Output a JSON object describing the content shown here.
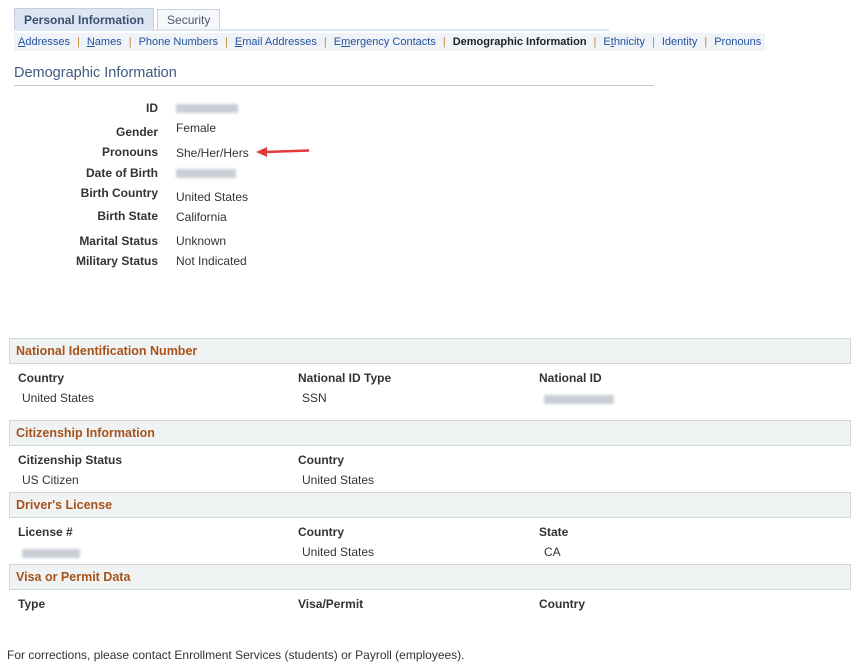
{
  "tabs": [
    {
      "label": "Personal Information",
      "active": true
    },
    {
      "label": "Security",
      "active": false
    }
  ],
  "subnav": {
    "items": [
      {
        "label": "Addresses",
        "access_key_index": 0,
        "current": false
      },
      {
        "label": "Names",
        "access_key_index": 0,
        "current": false
      },
      {
        "label": "Phone Numbers",
        "access_key_index": -1,
        "current": false
      },
      {
        "label": "Email Addresses",
        "access_key_index": 0,
        "current": false
      },
      {
        "label": "Emergency Contacts",
        "access_key_index": 1,
        "current": false
      },
      {
        "label": "Demographic Information",
        "access_key_index": -1,
        "current": true
      },
      {
        "label": "Ethnicity",
        "access_key_index": 1,
        "current": false
      },
      {
        "label": "Identity",
        "access_key_index": -1,
        "current": false
      },
      {
        "label": "Pronouns",
        "access_key_index": -1,
        "current": false
      }
    ],
    "separator": "|"
  },
  "page_title": "Demographic Information",
  "demographics": {
    "id": {
      "label": "ID",
      "value": "[redacted]"
    },
    "gender": {
      "label": "Gender",
      "value": "Female"
    },
    "pronouns": {
      "label": "Pronouns",
      "value": "She/Her/Hers"
    },
    "dob": {
      "label": "Date of Birth",
      "value": "[redacted]"
    },
    "birth_country": {
      "label": "Birth Country",
      "value": "United States"
    },
    "birth_state": {
      "label": "Birth State",
      "value": "California"
    },
    "marital": {
      "label": "Marital Status",
      "value": "Unknown"
    },
    "military": {
      "label": "Military Status",
      "value": "Not Indicated"
    }
  },
  "annotation": {
    "arrow_color": "#e03a3a",
    "points_to": "pronouns"
  },
  "national_id": {
    "title": "National Identification Number",
    "headers": [
      "Country",
      "National ID Type",
      "National ID"
    ],
    "row": [
      "United States",
      "SSN",
      "[redacted]"
    ]
  },
  "citizenship": {
    "title": "Citizenship Information",
    "headers": [
      "Citizenship Status",
      "Country"
    ],
    "row": [
      "US Citizen",
      "United States"
    ]
  },
  "drivers_license": {
    "title": "Driver's License",
    "headers": [
      "License #",
      "Country",
      "State"
    ],
    "row": [
      "[redacted]",
      "United States",
      "CA"
    ]
  },
  "visa": {
    "title": "Visa or Permit Data",
    "headers": [
      "Type",
      "Visa/Permit",
      "Country"
    ]
  },
  "footer": "For corrections, please contact Enrollment Services (students) or Payroll (employees).",
  "colors": {
    "section_title": "#a8521b",
    "link": "#22529c",
    "page_title": "#3e5a80",
    "separator": "#c08a3e"
  }
}
